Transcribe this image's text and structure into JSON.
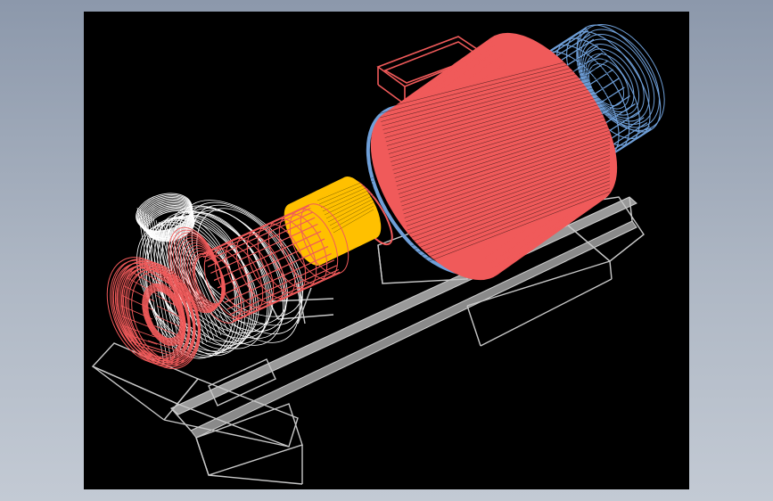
{
  "viewer": {
    "background_color": "#000000",
    "page_gradient": [
      "#8c98ab",
      "#c3cad4"
    ]
  },
  "model": {
    "components": [
      {
        "name": "motor-housing",
        "color": "#f05a5a"
      },
      {
        "name": "motor-fan-cover",
        "color": "#6f9fd8"
      },
      {
        "name": "terminal-box",
        "color": "#f05a5a"
      },
      {
        "name": "coupling",
        "color": "#ffc000"
      },
      {
        "name": "pump-shaft-bearing",
        "color": "#f05a5a"
      },
      {
        "name": "pump-volute-casing",
        "color": "#ffffff"
      },
      {
        "name": "suction-flange",
        "color": "#f05a5a"
      },
      {
        "name": "base-frame",
        "color": "#c8c8c8"
      }
    ]
  }
}
